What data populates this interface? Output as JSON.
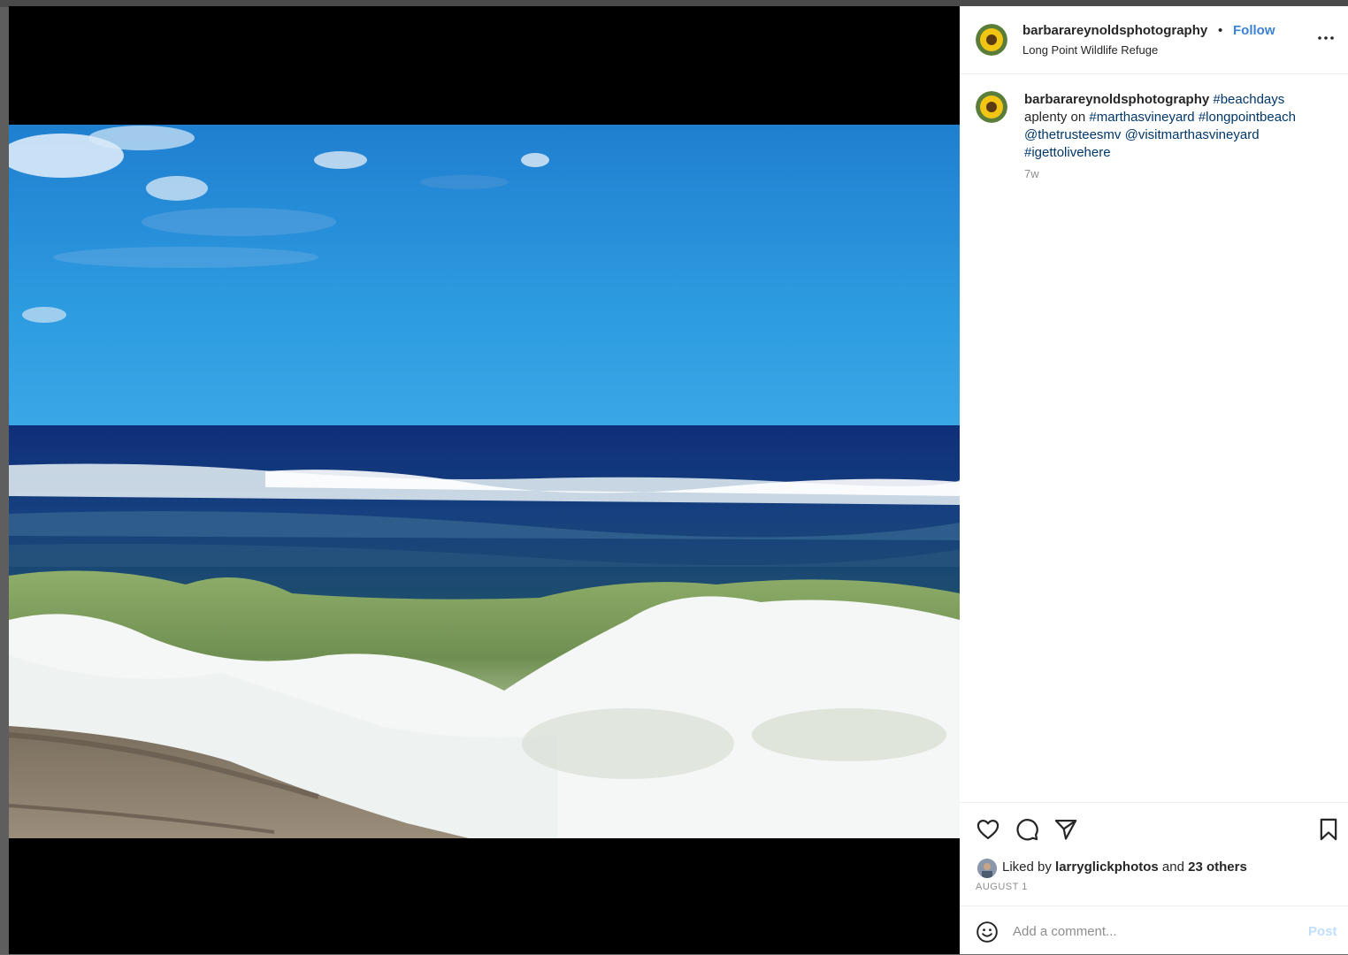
{
  "post": {
    "username": "barbarareynoldsphotography",
    "separator": "•",
    "follow_label": "Follow",
    "location": "Long Point Wildlife Refuge",
    "more_icon": "more-options-icon"
  },
  "caption": {
    "username": "barbarareynoldsphotography",
    "tag1": "#beachdays",
    "text1": "aplenty on",
    "tag2": "#marthasvineyard",
    "tag3": "#longpointbeach",
    "mention1": "@thetrusteesmv",
    "mention2": "@visitmarthasvineyard",
    "tag4": "#igettolivehere",
    "time": "7w"
  },
  "actions": {
    "like_icon": "heart-icon",
    "comment_icon": "comment-icon",
    "share_icon": "share-icon",
    "save_icon": "bookmark-icon"
  },
  "likes": {
    "prefix": "Liked by",
    "user": "larryglickphotos",
    "and": "and",
    "others": "23 others"
  },
  "date": "AUGUST 1",
  "comment": {
    "placeholder": "Add a comment...",
    "post_label": "Post"
  },
  "colors": {
    "follow": "#3b82d6",
    "hashtag": "#00376b",
    "post_disabled": "#c0dffd"
  }
}
